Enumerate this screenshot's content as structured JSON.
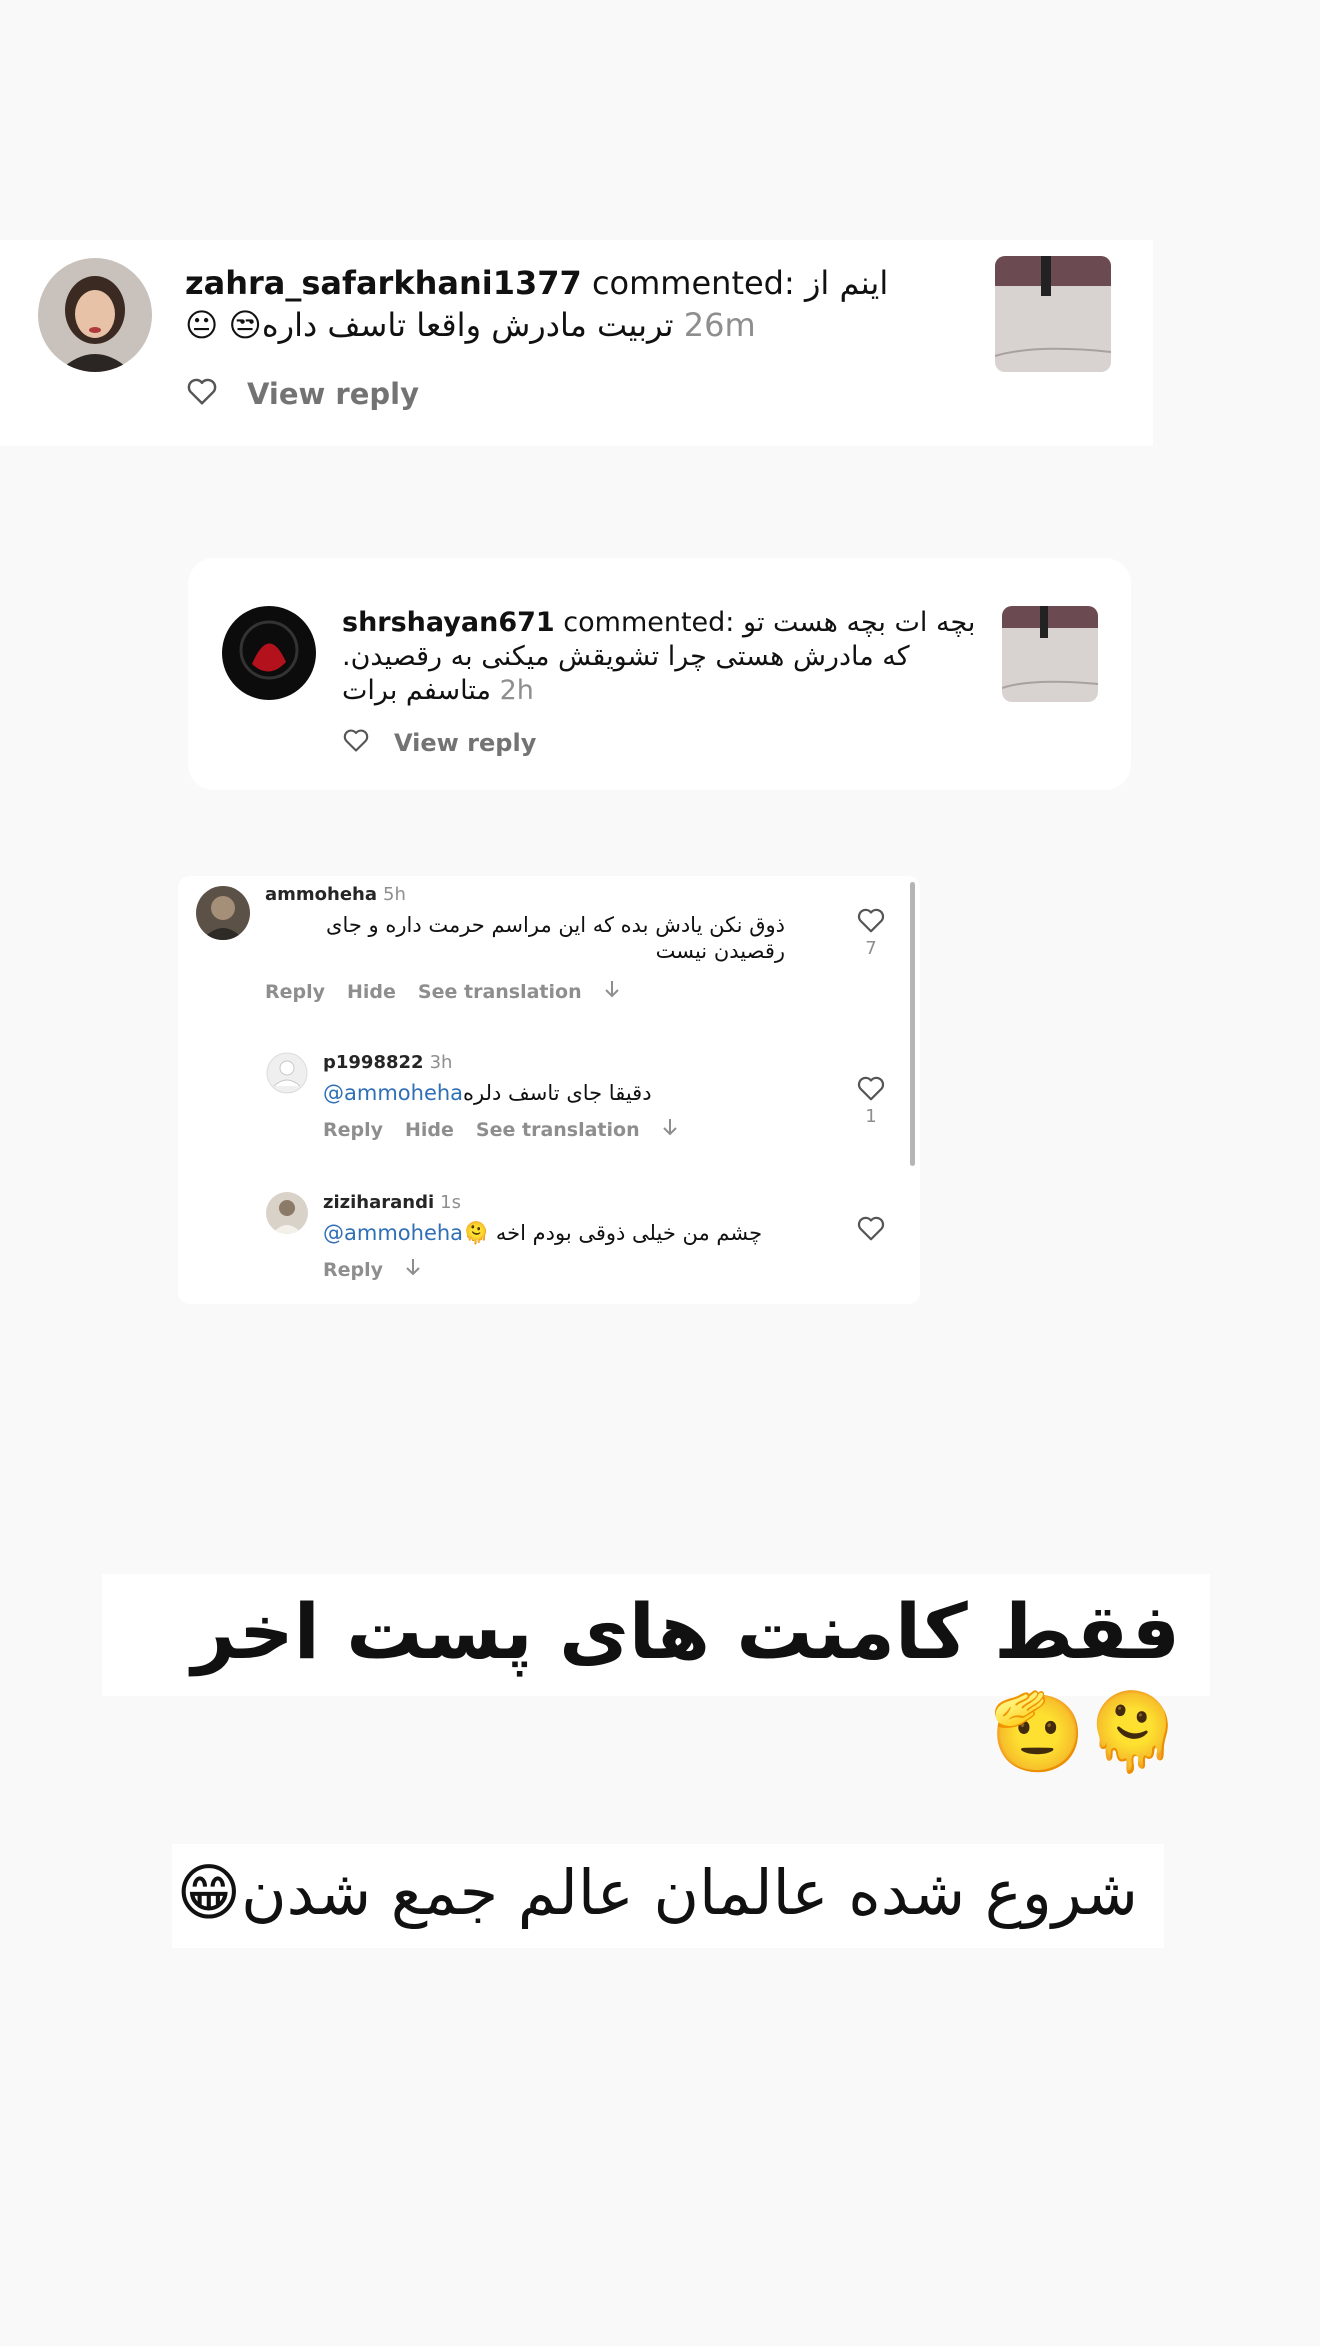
{
  "comment1": {
    "username": "zahra_safarkhani1377",
    "verb": " commented: ",
    "text": "اینم از تربیت مادرش واقعا تاسف داره😒 😐",
    "time": " 26m",
    "view_reply": "View reply"
  },
  "comment2": {
    "username": "shrshayan671",
    "verb": " commented: ",
    "text": "بچه ات بچه هست تو که مادرش هستی چرا تشویقش میکنی به رقصیدن. متاسفم برات",
    "time": " 2h",
    "view_reply": "View reply"
  },
  "thread": {
    "main": {
      "username": "ammoheha",
      "time": "5h",
      "text": "ذوق نکن یادش بده که این مراسم حرمت داره و جای رقصیدن نیست",
      "reply": "Reply",
      "hide": "Hide",
      "translate": "See translation",
      "likes": "7"
    },
    "reply1": {
      "username": "p1998822",
      "time": "3h",
      "mention": "@ammoheha",
      "text": " دقیقا جای تاسف دلره",
      "reply": "Reply",
      "hide": "Hide",
      "translate": "See translation",
      "likes": "1"
    },
    "reply2": {
      "username": "ziziharandi",
      "time": "1s",
      "mention": "@ammoheha",
      "text": " چشم من خیلی ذوقی بودم اخه 🫠",
      "reply": "Reply"
    }
  },
  "banner1": "فقط کامنت های پست اخر 🫠🫡",
  "banner2": "شروع شده عالمان عالم جمع شدن😁",
  "colors": {
    "mention": "#2f6fb5",
    "muted": "#8e8e8e",
    "card": "#ffffff",
    "background": "#f9f9f9"
  }
}
